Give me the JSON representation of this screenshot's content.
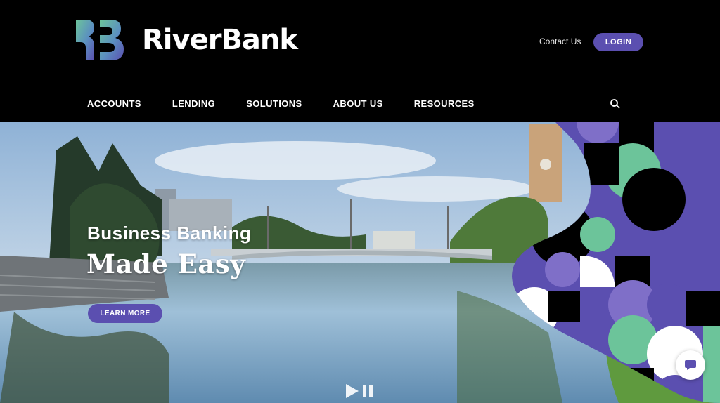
{
  "brand": {
    "name": "RiverBank",
    "colors": {
      "primary": "#5b4fb0",
      "green": "#6cc49a",
      "black": "#000000"
    }
  },
  "header": {
    "contact_label": "Contact Us",
    "login_label": "LOGIN"
  },
  "nav": {
    "items": [
      {
        "label": "ACCOUNTS"
      },
      {
        "label": "LENDING"
      },
      {
        "label": "SOLUTIONS"
      },
      {
        "label": "ABOUT US"
      },
      {
        "label": "RESOURCES"
      }
    ],
    "search_icon": "search-icon"
  },
  "hero": {
    "subtitle": "Business Banking",
    "title": "Made Easy",
    "cta_label": "LEARN MORE",
    "media_controls": [
      "play-icon",
      "pause-icon"
    ]
  },
  "chat": {
    "icon": "chat-bubble-icon"
  }
}
